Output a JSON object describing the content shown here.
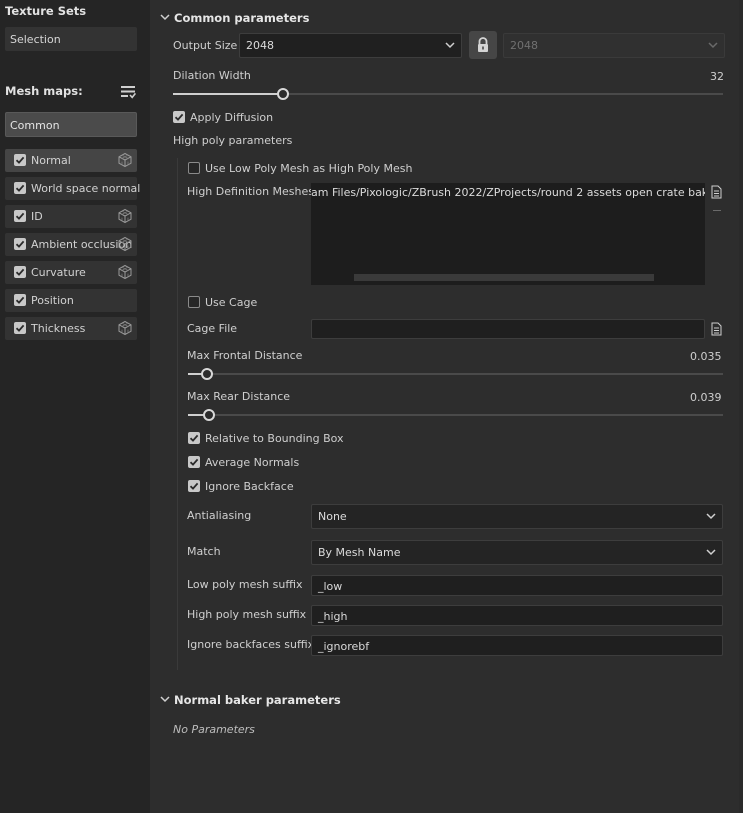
{
  "left_panel": {
    "texture_sets_title": "Texture Sets",
    "selection_label": "Selection",
    "mesh_maps_title": "Mesh maps:",
    "common_label": "Common",
    "mesh_maps": [
      {
        "label": "Normal",
        "checked": true,
        "active": true,
        "has_cube_icon": true
      },
      {
        "label": "World space normal",
        "checked": true,
        "active": false,
        "has_cube_icon": false
      },
      {
        "label": "ID",
        "checked": true,
        "active": false,
        "has_cube_icon": true
      },
      {
        "label": "Ambient occlusion",
        "checked": true,
        "active": false,
        "has_cube_icon": true
      },
      {
        "label": "Curvature",
        "checked": true,
        "active": false,
        "has_cube_icon": true
      },
      {
        "label": "Position",
        "checked": true,
        "active": false,
        "has_cube_icon": false
      },
      {
        "label": "Thickness",
        "checked": true,
        "active": false,
        "has_cube_icon": true
      }
    ]
  },
  "common": {
    "title": "Common parameters",
    "output_size_label": "Output Size",
    "output_size_value": "2048",
    "output_size_locked_value": "2048",
    "dilation_label": "Dilation Width",
    "dilation_value": "32",
    "dilation_fraction": 0.2,
    "apply_diffusion_label": "Apply Diffusion",
    "apply_diffusion_checked": true,
    "high_poly_title": "High poly parameters",
    "use_low_poly_label": "Use Low Poly Mesh as High Poly Mesh",
    "use_low_poly_checked": false,
    "high_def_meshes_label": "High Definition Meshes",
    "high_def_meshes_value": "am Files/Pixologic/ZBrush 2022/ZProjects/round 2 assets open crate bake_high",
    "use_cage_label": "Use Cage",
    "use_cage_checked": false,
    "cage_file_label": "Cage File",
    "cage_file_value": "",
    "max_frontal_label": "Max Frontal Distance",
    "max_frontal_value": "0.035",
    "max_frontal_fraction": 0.035,
    "max_rear_label": "Max Rear Distance",
    "max_rear_value": "0.039",
    "max_rear_fraction": 0.039,
    "relative_bbox_label": "Relative to Bounding Box",
    "relative_bbox_checked": true,
    "average_normals_label": "Average Normals",
    "average_normals_checked": true,
    "ignore_backface_label": "Ignore Backface",
    "ignore_backface_checked": true,
    "antialiasing_label": "Antialiasing",
    "antialiasing_value": "None",
    "match_label": "Match",
    "match_value": "By Mesh Name",
    "low_suffix_label": "Low poly mesh suffix",
    "low_suffix_value": "_low",
    "high_suffix_label": "High poly mesh suffix",
    "high_suffix_value": "_high",
    "ignore_suffix_label": "Ignore backfaces suffix",
    "ignore_suffix_value": "_ignorebf"
  },
  "normal_baker": {
    "title": "Normal baker parameters",
    "no_params": "No Parameters"
  },
  "colors": {
    "panel_bg": "#2d2d2d",
    "left_bg": "#252525",
    "input_bg": "#1f1f1f",
    "accent": "#cfcfcf"
  }
}
